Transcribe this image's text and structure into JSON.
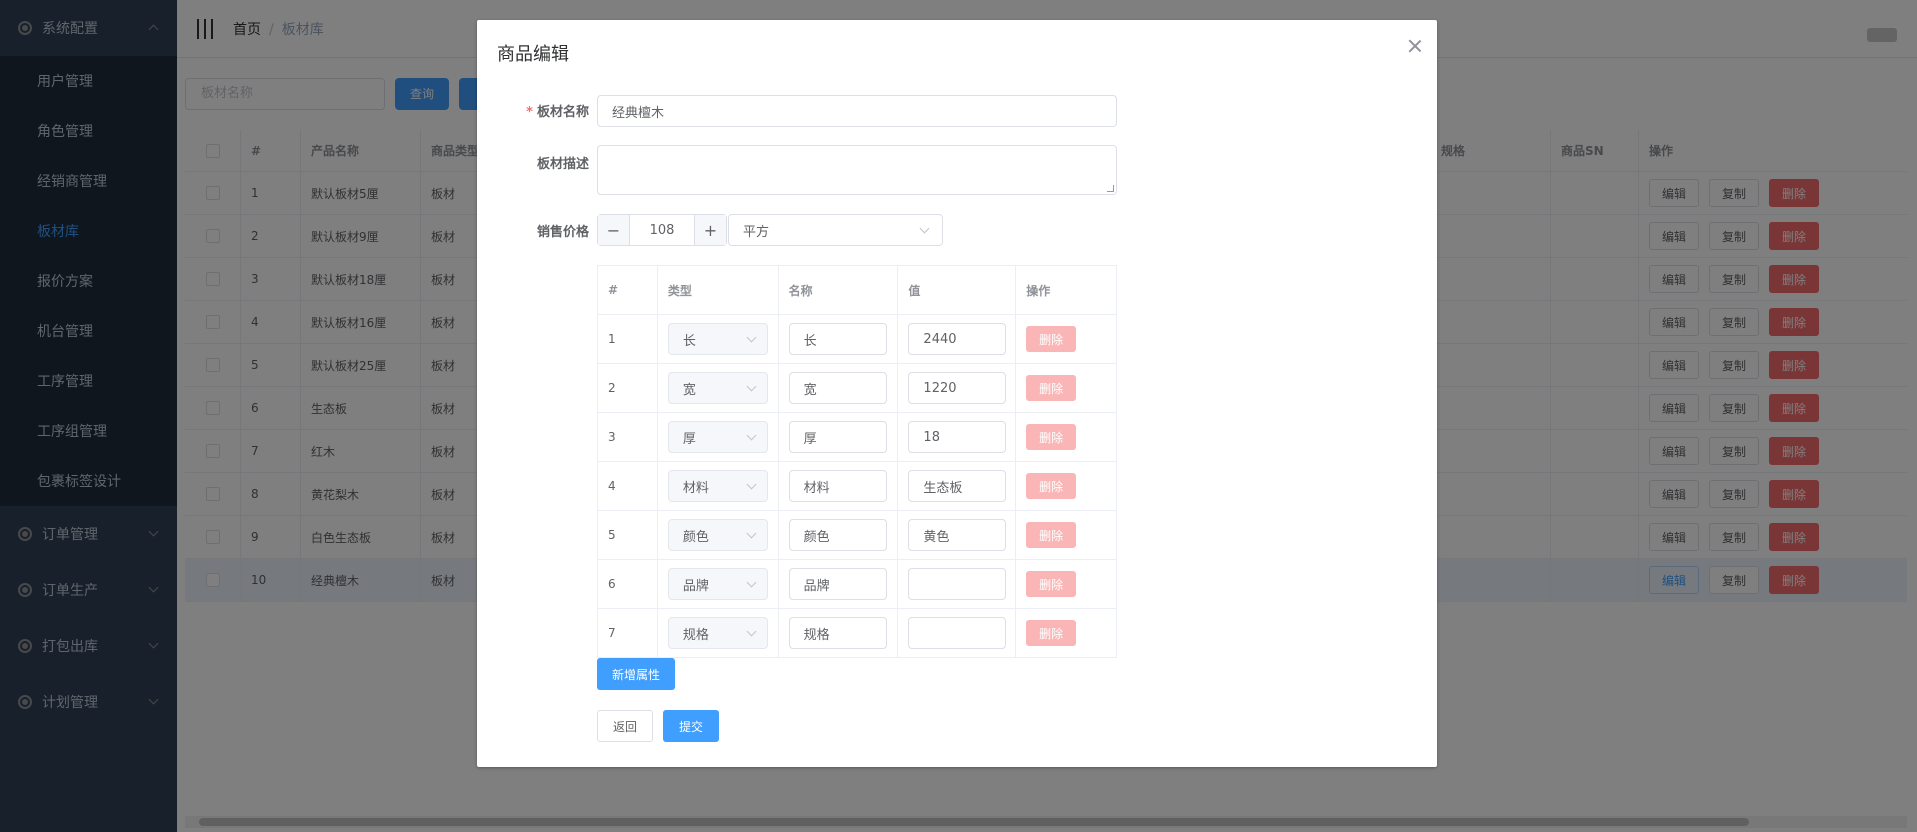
{
  "sidebar": {
    "group_system": "系统配置",
    "items": [
      "用户管理",
      "角色管理",
      "经销商管理",
      "板材库",
      "报价方案",
      "机台管理",
      "工序管理",
      "工序组管理",
      "包裹标签设计"
    ],
    "group_order": "订单管理",
    "group_production": "订单生产",
    "group_pack": "打包出库",
    "group_plan": "计划管理"
  },
  "breadcrumb": {
    "home": "首页",
    "current": "板材库"
  },
  "toolbar": {
    "search_placeholder": "板材名称",
    "query_label": "查询"
  },
  "table": {
    "headers": {
      "index": "#",
      "name": "产品名称",
      "type": "商品类型",
      "spec": "规格",
      "sn": "商品SN",
      "ops": "操作"
    },
    "rows": [
      {
        "idx": "1",
        "name": "默认板材5厘",
        "type": "板材"
      },
      {
        "idx": "2",
        "name": "默认板材9厘",
        "type": "板材"
      },
      {
        "idx": "3",
        "name": "默认板材18厘",
        "type": "板材"
      },
      {
        "idx": "4",
        "name": "默认板材16厘",
        "type": "板材"
      },
      {
        "idx": "5",
        "name": "默认板材25厘",
        "type": "板材"
      },
      {
        "idx": "6",
        "name": "生态板",
        "type": "板材"
      },
      {
        "idx": "7",
        "name": "红木",
        "type": "板材"
      },
      {
        "idx": "8",
        "name": "黄花梨木",
        "type": "板材"
      },
      {
        "idx": "9",
        "name": "白色生态板",
        "type": "板材"
      },
      {
        "idx": "10",
        "name": "经典檀木",
        "type": "板材"
      }
    ],
    "edit_label": "编辑",
    "copy_label": "复制",
    "delete_label": "删除"
  },
  "dialog": {
    "title": "商品编辑",
    "required_mark": "*",
    "name_label": "板材名称",
    "name_value": "经典檀木",
    "desc_label": "板材描述",
    "desc_value": "",
    "price_label": "销售价格",
    "price_minus": "−",
    "price_value": "108",
    "price_plus": "+",
    "unit_value": "平方",
    "attr_headers": {
      "index": "#",
      "type": "类型",
      "name": "名称",
      "value": "值",
      "ops": "操作"
    },
    "attrs": [
      {
        "idx": "1",
        "type": "长",
        "name": "长",
        "value": "2440"
      },
      {
        "idx": "2",
        "type": "宽",
        "name": "宽",
        "value": "1220"
      },
      {
        "idx": "3",
        "type": "厚",
        "name": "厚",
        "value": "18"
      },
      {
        "idx": "4",
        "type": "材料",
        "name": "材料",
        "value": "生态板"
      },
      {
        "idx": "5",
        "type": "颜色",
        "name": "颜色",
        "value": "黄色"
      },
      {
        "idx": "6",
        "type": "品牌",
        "name": "品牌",
        "value": ""
      },
      {
        "idx": "7",
        "type": "规格",
        "name": "规格",
        "value": ""
      }
    ],
    "attr_delete_label": "删除",
    "add_attr_label": "新增属性",
    "back_label": "返回",
    "submit_label": "提交"
  },
  "colors": {
    "primary": "#409eff",
    "danger": "#f56c6c",
    "sidebar_bg": "#304156",
    "sidebar_active": "#409eff"
  }
}
